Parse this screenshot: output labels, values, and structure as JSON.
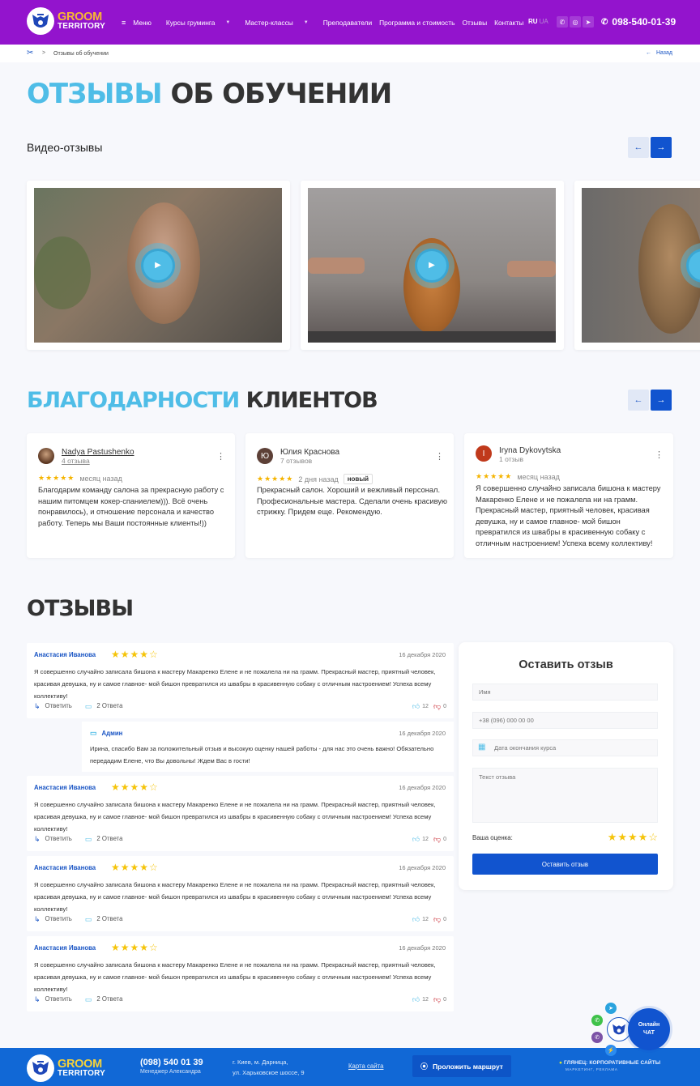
{
  "header": {
    "logo": {
      "line1": "GROOM",
      "line2": "TERRITORY"
    },
    "nav": [
      {
        "label": "Меню",
        "icon": "menu-icon",
        "dropdown": false
      },
      {
        "label": "Курсы груминга",
        "dropdown": true
      },
      {
        "label": "Мастер-классы",
        "dropdown": true
      },
      {
        "label": "Преподаватели",
        "dropdown": false
      },
      {
        "label": "Программа и стоимость",
        "dropdown": false
      },
      {
        "label": "Отзывы",
        "dropdown": false
      },
      {
        "label": "Контакты",
        "dropdown": false
      }
    ],
    "lang": {
      "active": "RU",
      "other": "UA"
    },
    "socials": [
      "viber-icon",
      "instagram-icon",
      "telegram-icon"
    ],
    "phone": "098-540-01-39",
    "colors": {
      "bg": "#9314cd",
      "logo_accent": "#f8b733"
    }
  },
  "breadcrumb": {
    "home_icon": "scissors-icon",
    "separator": ">",
    "current": "Отзывы об обучении",
    "back": "Назад"
  },
  "page_title": {
    "accent": "ОТЗЫВЫ",
    "rest": "ОБ ОБУЧЕНИИ"
  },
  "videos": {
    "title": "Видео-отзывы",
    "prev": "←",
    "next": "→",
    "items": [
      {
        "subject": "smiling woman",
        "icon": "play-icon"
      },
      {
        "subject": "pomeranian grooming",
        "icon": "play-icon"
      },
      {
        "subject": "yorkshire terrier",
        "icon": "play-icon"
      }
    ]
  },
  "thanks": {
    "title_accent": "БЛАГОДАРНОСТИ",
    "title_rest": "КЛИЕНТОВ",
    "prev": "←",
    "next": "→",
    "cards": [
      {
        "name": "Nadya Pastushenko",
        "count": "4 отзыва",
        "avatar": "",
        "avatar_color": "#6b3c22",
        "stars": 5,
        "stars_text": "★★★★★",
        "when": "месяц назад",
        "badge": "",
        "text": "Благодарим команду салона за прекрасную работу с нашим питомцем кокер-спаниелем))). Всё очень понравилось), и отношение персонала и качество работу. Теперь мы Ваши постоянные клиенты!))"
      },
      {
        "name": "Юлия Краснова",
        "count": "7 отзывов",
        "avatar": "Ю",
        "avatar_color": "#5d4037",
        "stars": 5,
        "stars_text": "★★★★★",
        "when": "2 дня назад",
        "badge": "новый",
        "text": "Прекрасный салон. Хороший и вежливый персонал. Професиональные мастера. Сделали очень красивую стрижку. Придем еще. Рекомендую."
      },
      {
        "name": "Iryna Dykovytska",
        "count": "1 отзыв",
        "avatar": "I",
        "avatar_color": "#c0391b",
        "stars": 5,
        "stars_text": "★★★★★",
        "when": "месяц назад",
        "badge": "",
        "text": "Я совершенно случайно записала бишона к мастеру Макаренко Елене и не пожалела ни на грамм. Прекрасный мастер, приятный человек, красивая девушка, ну и самое главное- мой бишон превратился из швабры в красивенную собаку с отличным настроением! Успеха всему коллективу!"
      }
    ]
  },
  "reviews": {
    "title": "ОТЗЫВЫ",
    "items": [
      {
        "name": "Анастасия Иванова",
        "rating": 4,
        "stars_full": "★★★★",
        "stars_empty": "☆",
        "date": "16 декабря 2020",
        "text": "Я совершенно случайно записала бишона к мастеру Макаренко Елене и не пожалела ни на грамм. Прекрасный мастер, приятный человек, красивая девушка, ну и самое главное- мой бишон превратился из швабры в красивенную собаку с отличным настроением! Успеха всему коллективу!",
        "reply_label": "Ответить",
        "answers_label": "2 Ответа",
        "likes": "12",
        "dislikes": "0"
      },
      {
        "name": "Анастасия Иванова",
        "rating": 4,
        "stars_full": "★★★★",
        "stars_empty": "☆",
        "date": "16 декабря 2020",
        "text": "Я совершенно случайно записала бишона к мастеру Макаренко Елене и не пожалела ни на грамм. Прекрасный мастер, приятный человек, красивая девушка, ну и самое главное- мой бишон превратился из швабры в красивенную собаку с отличным настроением! Успеха всему коллективу!",
        "reply_label": "Ответить",
        "answers_label": "2 Ответа",
        "likes": "12",
        "dislikes": "0"
      },
      {
        "name": "Анастасия Иванова",
        "rating": 4,
        "stars_full": "★★★★",
        "stars_empty": "☆",
        "date": "16 декабря 2020",
        "text": "Я совершенно случайно записала бишона к мастеру Макаренко Елене и не пожалела ни на грамм. Прекрасный мастер, приятный человек, красивая девушка, ну и самое главное- мой бишон превратился из швабры в красивенную собаку с отличным настроением! Успеха всему коллективу!",
        "reply_label": "Ответить",
        "answers_label": "2 Ответа",
        "likes": "12",
        "dislikes": "0"
      },
      {
        "name": "Анастасия Иванова",
        "rating": 4,
        "stars_full": "★★★★",
        "stars_empty": "☆",
        "date": "16 декабря 2020",
        "text": "Я совершенно случайно записала бишона к мастеру Макаренко Елене и не пожалела ни на грамм. Прекрасный мастер, приятный человек, красивая девушка, ну и самое главное- мой бишон превратился из швабры в красивенную собаку с отличным настроением! Успеха всему коллективу!",
        "reply_label": "Ответить",
        "answers_label": "2 Ответа",
        "likes": "12",
        "dislikes": "0"
      }
    ],
    "admin_reply": {
      "name": "Админ",
      "date": "16 декабря 2020",
      "text": "Ирина, спасибо Вам за положительный отзыв и высокую оценку нашей работы - для нас это очень важно! Обязательно передадим Елене, что Вы довольны! Ждем Вас в гости!"
    }
  },
  "form": {
    "title": "Оставить отзыв",
    "name_placeholder": "Имя",
    "phone_placeholder": "+38 (096) 000 00 00",
    "date_placeholder": "Дата окончания курса",
    "text_placeholder": "Текст отзыва",
    "rating_label": "Ваша оценка:",
    "rating": 4,
    "rating_full": "★★★★",
    "rating_empty": "☆",
    "submit": "Оставить отзыв"
  },
  "footer": {
    "logo": {
      "line1": "GROOM",
      "line2": "TERRITORY"
    },
    "phone": "(098) 540 01 39",
    "manager": "Менеджер Александра",
    "address_line1": "г. Киев, м. Дарница,",
    "address_line2": "ул. Харьковское шоссе, 9",
    "sitemap": "Карта сайта",
    "route_button": "Проложить маршрут",
    "developer": "ГЛЯНЕЦ: КОРПОРАТИВНЫЕ САЙТЫ",
    "developer_sub": "МАРКЕТИНГ, РЕКЛАМА",
    "bg_color": "#1168d6"
  },
  "chat": {
    "line1": "Онлайн",
    "line2": "ЧАТ",
    "channels": [
      "telegram-icon",
      "whatsapp-icon",
      "viber-icon",
      "messenger-icon"
    ]
  }
}
